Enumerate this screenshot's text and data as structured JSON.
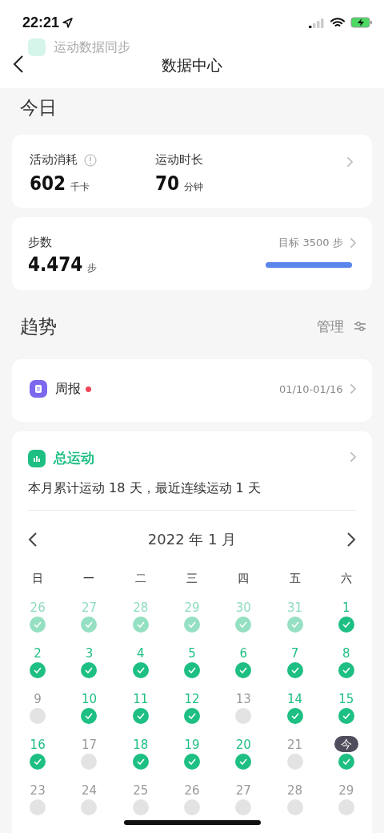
{
  "status_bar": {
    "time": "22:21"
  },
  "ghost_row": {
    "label": "运动数据同步"
  },
  "nav": {
    "title": "数据中心"
  },
  "today_section": {
    "title": "今日"
  },
  "activity_card": {
    "metrics": [
      {
        "label": "活动消耗",
        "value": "602",
        "unit": "千卡",
        "info": true
      },
      {
        "label": "运动时长",
        "value": "70",
        "unit": "分钟"
      }
    ]
  },
  "steps_card": {
    "label": "步数",
    "value": "4.474",
    "unit": "步",
    "goal": "目标 3500 步",
    "level": 1
  },
  "trend_section": {
    "title": "趋势",
    "manage": "管理"
  },
  "weekly_card": {
    "label": "周报",
    "unread": true,
    "range": "01/10-01/16"
  },
  "exercise_card": {
    "title": "总运动",
    "summary": "本月累计运动 18 天，最近连续运动 1 天",
    "month": "2022 年 1 月",
    "weekdays": [
      "日",
      "一",
      "二",
      "三",
      "四",
      "五",
      "六"
    ],
    "days": [
      {
        "label": "26",
        "kind": "outside",
        "done": true,
        "today": false
      },
      {
        "label": "27",
        "kind": "outside",
        "done": true,
        "today": false
      },
      {
        "label": "28",
        "kind": "outside",
        "done": true,
        "today": false
      },
      {
        "label": "29",
        "kind": "outside",
        "done": true,
        "today": false
      },
      {
        "label": "30",
        "kind": "outside",
        "done": true,
        "today": false
      },
      {
        "label": "31",
        "kind": "outside",
        "done": true,
        "today": false
      },
      {
        "label": "1",
        "kind": "current",
        "done": true,
        "today": false
      },
      {
        "label": "2",
        "kind": "current",
        "done": true,
        "today": false
      },
      {
        "label": "3",
        "kind": "current",
        "done": true,
        "today": false
      },
      {
        "label": "4",
        "kind": "current",
        "done": true,
        "today": false
      },
      {
        "label": "5",
        "kind": "current",
        "done": true,
        "today": false
      },
      {
        "label": "6",
        "kind": "current",
        "done": true,
        "today": false
      },
      {
        "label": "7",
        "kind": "current",
        "done": true,
        "today": false
      },
      {
        "label": "8",
        "kind": "current",
        "done": true,
        "today": false
      },
      {
        "label": "9",
        "kind": "current",
        "done": false,
        "today": false
      },
      {
        "label": "10",
        "kind": "current",
        "done": true,
        "today": false
      },
      {
        "label": "11",
        "kind": "current",
        "done": true,
        "today": false
      },
      {
        "label": "12",
        "kind": "current",
        "done": true,
        "today": false
      },
      {
        "label": "13",
        "kind": "current",
        "done": false,
        "today": false
      },
      {
        "label": "14",
        "kind": "current",
        "done": true,
        "today": false
      },
      {
        "label": "15",
        "kind": "current",
        "done": true,
        "today": false
      },
      {
        "label": "16",
        "kind": "current",
        "done": true,
        "today": false
      },
      {
        "label": "17",
        "kind": "current",
        "done": false,
        "today": false
      },
      {
        "label": "18",
        "kind": "current",
        "done": true,
        "today": false
      },
      {
        "label": "19",
        "kind": "current",
        "done": true,
        "today": false
      },
      {
        "label": "20",
        "kind": "current",
        "done": true,
        "today": false
      },
      {
        "label": "21",
        "kind": "current",
        "done": false,
        "today": false
      },
      {
        "label": "今",
        "kind": "current",
        "done": true,
        "today": true
      },
      {
        "label": "23",
        "kind": "future",
        "done": false,
        "today": false
      },
      {
        "label": "24",
        "kind": "future",
        "done": false,
        "today": false
      },
      {
        "label": "25",
        "kind": "future",
        "done": false,
        "today": false
      },
      {
        "label": "26",
        "kind": "future",
        "done": false,
        "today": false
      },
      {
        "label": "27",
        "kind": "future",
        "done": false,
        "today": false
      },
      {
        "label": "28",
        "kind": "future",
        "done": false,
        "today": false
      },
      {
        "label": "29",
        "kind": "future",
        "done": false,
        "today": false
      }
    ]
  }
}
